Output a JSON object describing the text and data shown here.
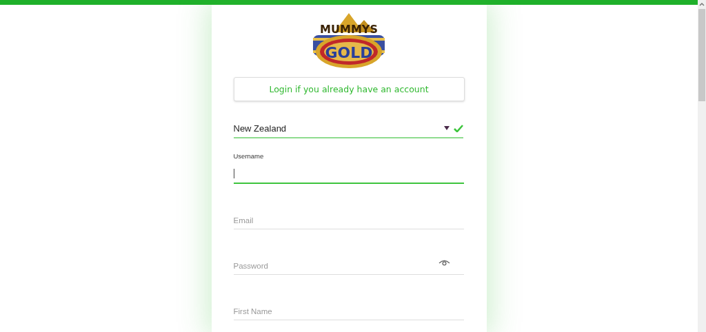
{
  "logo": {
    "top_word": "MUMMYS",
    "bottom_word": "GOLD"
  },
  "login_button": {
    "label": "Login if you already have an account"
  },
  "country_select": {
    "value": "New Zealand",
    "valid": true
  },
  "fields": [
    {
      "kind": "text",
      "label": "Username",
      "focused": true
    },
    {
      "kind": "text",
      "placeholder": "Email",
      "focused": false
    },
    {
      "kind": "password",
      "placeholder": "Password",
      "focused": false
    },
    {
      "kind": "text",
      "placeholder": "First Name",
      "focused": false
    }
  ]
}
